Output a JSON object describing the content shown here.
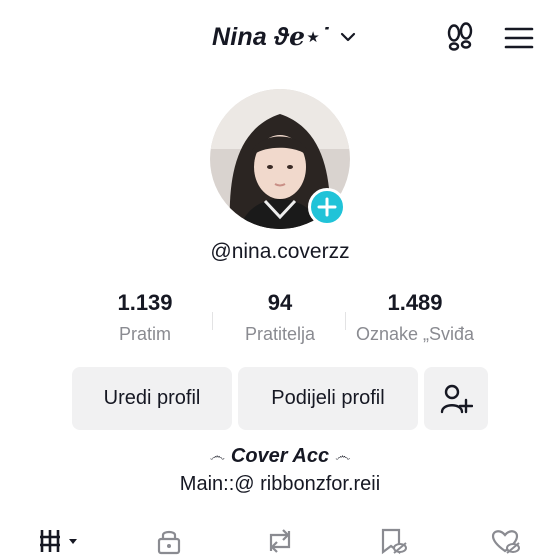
{
  "header": {
    "username_display": "Nina ϑℯ⋆˙",
    "icons": [
      "chevron-down-icon",
      "footprint-icon",
      "menu-icon"
    ]
  },
  "profile": {
    "handle": "@nina.coverzz",
    "colors": {
      "badge": "#20c3d8",
      "label_gray": "#8a8b91",
      "button_bg": "#f1f1f2"
    }
  },
  "stats": [
    {
      "value": "1.139",
      "label": "Pratim"
    },
    {
      "value": "94",
      "label": "Pratitelja"
    },
    {
      "value": "1.489",
      "label": "Oznake „Sviđa"
    }
  ],
  "actions": {
    "edit": "Uredi profil",
    "share": "Podijeli profil"
  },
  "bio": {
    "symbol": "෴",
    "title": "Cover Acc",
    "line": "Main::@ ribbonzfor.reii"
  },
  "tabs": [
    "grid-icon",
    "lock-icon",
    "repost-icon",
    "saved-icon",
    "liked-icon"
  ]
}
